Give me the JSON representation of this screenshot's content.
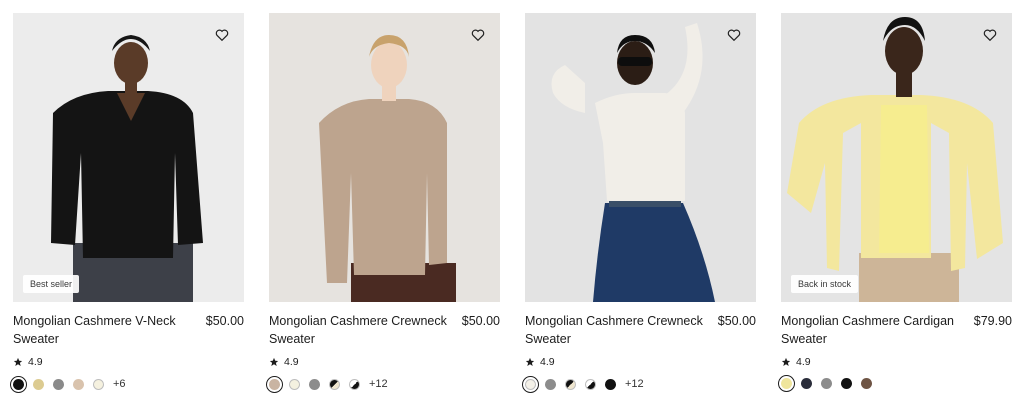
{
  "products": [
    {
      "name": "Mongolian Cashmere V-Neck Sweater",
      "price": "$50.00",
      "rating": "4.9",
      "badge": "Best seller",
      "more": "+6",
      "swatch_colors": [
        "#111111",
        "#dccb91",
        "#8a8a8a",
        "#d9c3ad",
        "#f5f1df"
      ]
    },
    {
      "name": "Mongolian Cashmere Crewneck Sweater",
      "price": "$50.00",
      "rating": "4.9",
      "badge": "",
      "more": "+12",
      "swatch_colors": [
        "#c9b4a2",
        "#f4f1e0",
        "#8c8c8c",
        "half-black-cream",
        "half-black-white"
      ]
    },
    {
      "name": "Mongolian Cashmere Crewneck Sweater",
      "price": "$50.00",
      "rating": "4.9",
      "badge": "",
      "more": "+12",
      "swatch_colors": [
        "#f4f1e8",
        "#8c8c8c",
        "half-black-cream",
        "half-black-white",
        "#111111"
      ]
    },
    {
      "name": "Mongolian Cashmere Cardigan Sweater",
      "price": "$79.90",
      "rating": "4.9",
      "badge": "Back in stock",
      "more": "",
      "swatch_colors": [
        "#efe59c",
        "#2a2d3a",
        "#8c8c8c",
        "#111111",
        "#6e5444"
      ]
    }
  ]
}
